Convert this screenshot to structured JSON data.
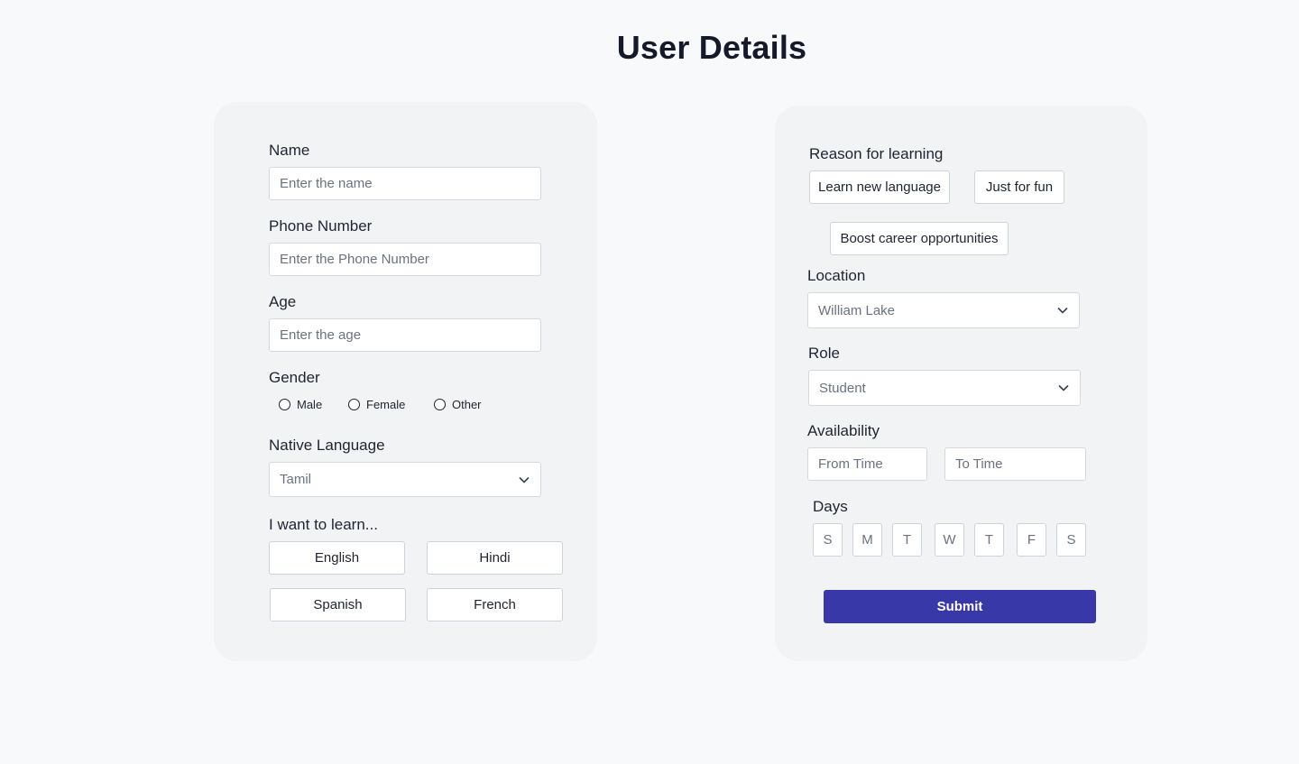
{
  "page": {
    "title": "User Details"
  },
  "left_form": {
    "name": {
      "label": "Name",
      "placeholder": "Enter the name"
    },
    "phone": {
      "label": "Phone Number",
      "placeholder": "Enter the Phone Number"
    },
    "age": {
      "label": "Age",
      "placeholder": "Enter the age"
    },
    "gender": {
      "label": "Gender",
      "options": [
        "Male",
        "Female",
        "Other"
      ]
    },
    "native_language": {
      "label": "Native Language",
      "selected": "Tamil"
    },
    "learn": {
      "label": "I want to learn...",
      "options": [
        "English",
        "Hindi",
        "Spanish",
        "French"
      ]
    }
  },
  "right_form": {
    "reason": {
      "label": "Reason for learning",
      "options": [
        "Learn new language",
        "Just for fun",
        "Boost career opportunities"
      ]
    },
    "location": {
      "label": "Location",
      "selected": "William Lake"
    },
    "role": {
      "label": "Role",
      "selected": "Student"
    },
    "availability": {
      "label": "Availability",
      "from_placeholder": "From Time",
      "to_placeholder": "To Time"
    },
    "days": {
      "label": "Days",
      "items": [
        "S",
        "M",
        "T",
        "W",
        "T",
        "F",
        "S"
      ]
    },
    "submit_label": "Submit"
  },
  "icons": {
    "dropdown": "chevron-down-icon",
    "radio": "radio-unchecked-icon"
  },
  "colors": {
    "primary": "#3838a8",
    "card": "#f2f3f5",
    "background": "#f8f9fb"
  }
}
